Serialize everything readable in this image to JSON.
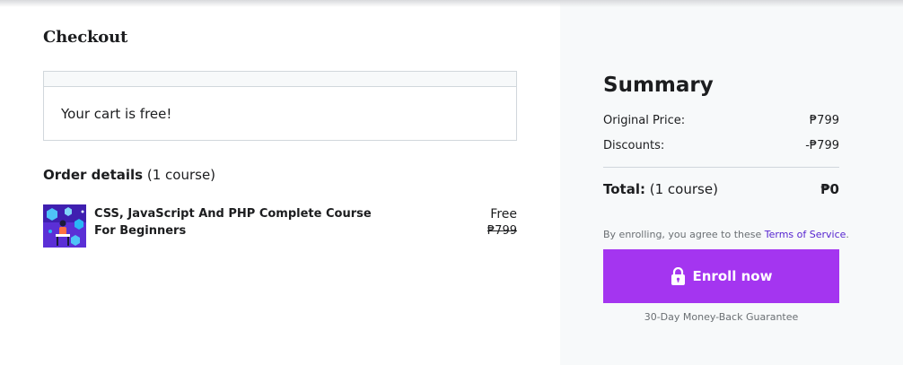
{
  "checkout": {
    "title": "Checkout",
    "cart_message": "Your cart is free!",
    "order_details_label": "Order details",
    "order_details_count": "(1 course)",
    "course": {
      "title": "CSS, JavaScript And PHP Complete Course For Beginners",
      "price": "Free",
      "original_price": "₱799"
    }
  },
  "summary": {
    "title": "Summary",
    "original_price_label": "Original Price:",
    "original_price_value": "₱799",
    "discounts_label": "Discounts:",
    "discounts_value": "-₱799",
    "total_label": "Total:",
    "total_count": "(1 course)",
    "total_value": "₱0",
    "terms_prefix": "By enrolling, you agree to these ",
    "terms_link": "Terms of Service",
    "terms_suffix": ".",
    "enroll_button": "Enroll now",
    "guarantee": "30-Day Money-Back Guarantee"
  },
  "colors": {
    "accent": "#a435f0",
    "link": "#5624d0",
    "summary_bg": "#f7f9fa",
    "text": "#1c1d1f",
    "muted": "#6a6f73"
  },
  "icons": {
    "enroll": "lock-icon",
    "course": "course-thumbnail"
  }
}
